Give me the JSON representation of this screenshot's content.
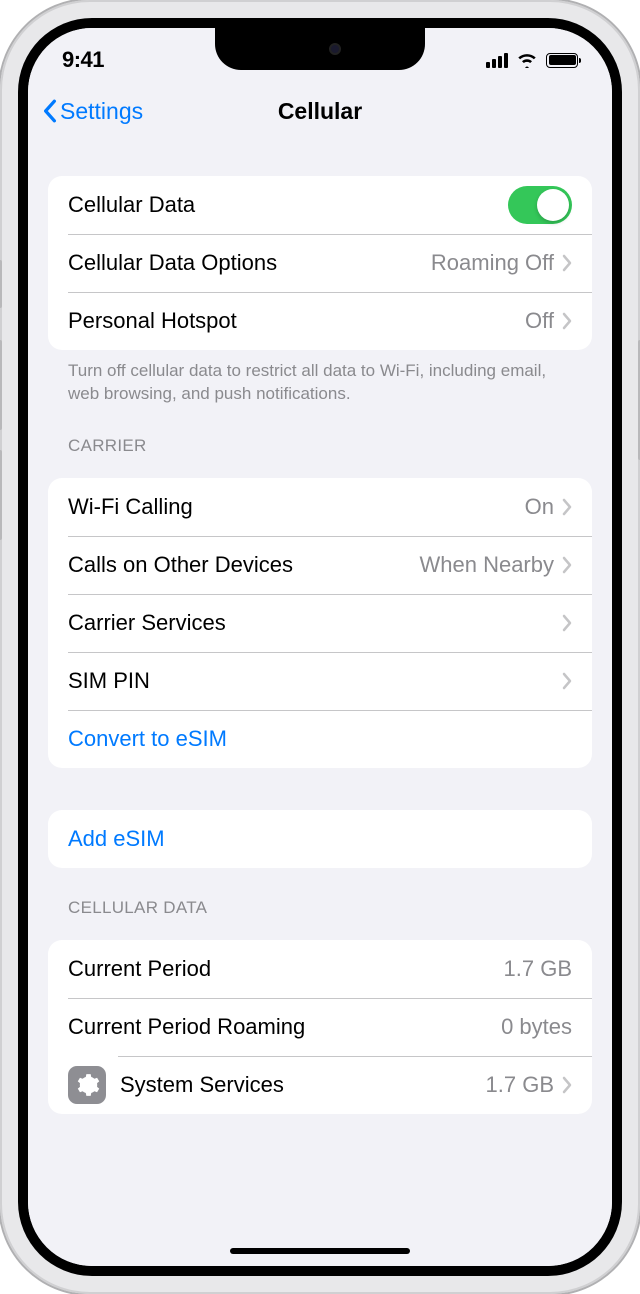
{
  "status": {
    "time": "9:41"
  },
  "nav": {
    "back": "Settings",
    "title": "Cellular"
  },
  "section1": {
    "cellular_data": "Cellular Data",
    "options": "Cellular Data Options",
    "options_value": "Roaming Off",
    "hotspot": "Personal Hotspot",
    "hotspot_value": "Off",
    "footer": "Turn off cellular data to restrict all data to Wi-Fi, including email, web browsing, and push notifications."
  },
  "carrier": {
    "header": "CARRIER",
    "wifi_calling": "Wi-Fi Calling",
    "wifi_calling_value": "On",
    "other_devices": "Calls on Other Devices",
    "other_devices_value": "When Nearby",
    "carrier_services": "Carrier Services",
    "sim_pin": "SIM PIN",
    "convert_esim": "Convert to eSIM"
  },
  "add_esim": "Add eSIM",
  "cellular_data_section": {
    "header": "CELLULAR DATA",
    "current_period": "Current Period",
    "current_period_value": "1.7 GB",
    "roaming": "Current Period Roaming",
    "roaming_value": "0 bytes",
    "system_services": "System Services",
    "system_services_value": "1.7 GB"
  }
}
